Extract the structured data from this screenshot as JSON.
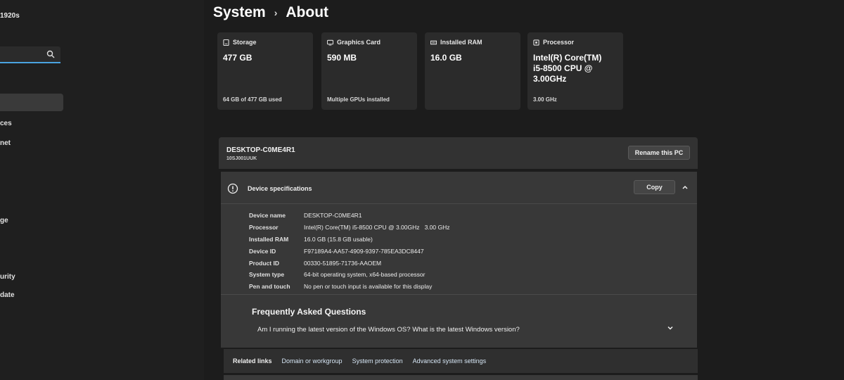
{
  "sidebar": {
    "profile_name": "1920s",
    "search_value": "",
    "items": [
      "ces",
      "net",
      "ge",
      "urity",
      "date"
    ]
  },
  "header": {
    "section": "System",
    "page": "About"
  },
  "cards": [
    {
      "title": "Storage",
      "icon": "storage-icon",
      "value": "477 GB",
      "sub": "64 GB of 477 GB used"
    },
    {
      "title": "Graphics Card",
      "icon": "graphics-card-icon",
      "value": "590 MB",
      "sub": "Multiple GPUs installed"
    },
    {
      "title": "Installed RAM",
      "icon": "ram-icon",
      "value": "16.0 GB",
      "sub": ""
    },
    {
      "title": "Processor",
      "icon": "processor-icon",
      "value": "Intel(R) Core(TM) i5-8500 CPU @ 3.00GHz",
      "sub": "3.00 GHz"
    }
  ],
  "device": {
    "name": "DESKTOP-C0ME4R1",
    "model": "10SJ001UUK",
    "rename_label": "Rename this PC"
  },
  "specs": {
    "title": "Device specifications",
    "copy_label": "Copy",
    "rows": [
      {
        "label": "Device name",
        "value": "DESKTOP-C0ME4R1"
      },
      {
        "label": "Processor",
        "value": "Intel(R) Core(TM) i5-8500 CPU @ 3.00GHz   3.00 GHz"
      },
      {
        "label": "Installed RAM",
        "value": "16.0 GB (15.8 GB usable)"
      },
      {
        "label": "Device ID",
        "value": "F97189A4-AA57-4909-9397-785EA3DC8447"
      },
      {
        "label": "Product ID",
        "value": "00330-51895-71736-AAOEM"
      },
      {
        "label": "System type",
        "value": "64-bit operating system, x64-based processor"
      },
      {
        "label": "Pen and touch",
        "value": "No pen or touch input is available for this display"
      }
    ]
  },
  "faq": {
    "title": "Frequently Asked Questions",
    "question": "Am I running the latest version of the Windows OS? What is the latest Windows version?"
  },
  "related": {
    "label": "Related links",
    "links": [
      "Domain or workgroup",
      "System protection",
      "Advanced system settings"
    ]
  }
}
